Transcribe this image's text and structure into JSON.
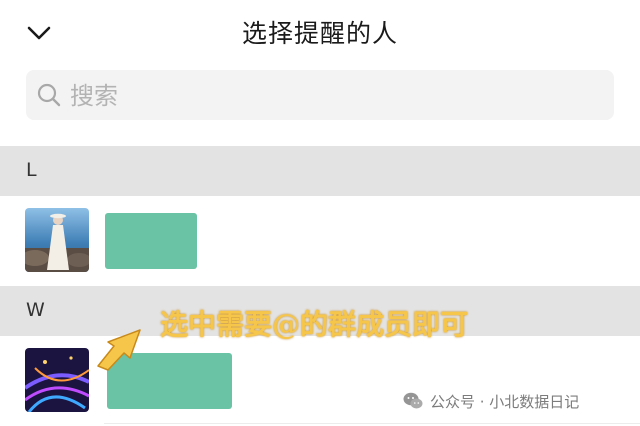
{
  "header": {
    "title": "选择提醒的人"
  },
  "search": {
    "placeholder": "搜索"
  },
  "sections": [
    {
      "letter": "L"
    },
    {
      "letter": "W"
    }
  ],
  "annotation": {
    "text": "选中需要@的群成员即可",
    "color": "#f6c64a"
  },
  "watermark": {
    "text": "公众号 · 小北数据日记"
  },
  "colors": {
    "redaction": "#69c3a4",
    "section_bg": "#e3e3e3",
    "search_bg": "#f3f3f3"
  },
  "icons": {
    "back": "chevron-down-icon",
    "search": "search-icon",
    "arrow": "arrow-pointer-icon",
    "watermark": "wechat-icon"
  }
}
